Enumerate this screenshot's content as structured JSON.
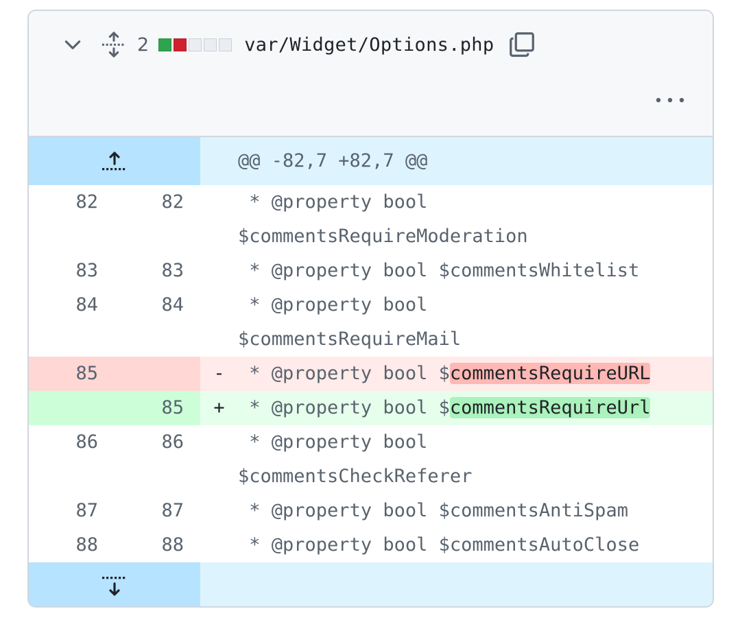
{
  "file_header": {
    "changes_count": "2",
    "diffstat": [
      "#2da44e",
      "#cf222e",
      "#eaeef2",
      "#eaeef2",
      "#eaeef2"
    ],
    "filename": "var/Widget/Options.php",
    "icons": [
      "chevron-down-icon",
      "expand-all-icon",
      "copy-icon",
      "kebab-horizontal-icon"
    ]
  },
  "hunk_header": "@@ -82,7 +82,7 @@",
  "lines": [
    {
      "type": "ctx",
      "old": "82",
      "new": "82",
      "marker": "",
      "prefix": " * @property bool\n$commentsRequireModeration",
      "hl": "",
      "suffix": ""
    },
    {
      "type": "ctx",
      "old": "83",
      "new": "83",
      "marker": "",
      "prefix": " * @property bool $commentsWhitelist",
      "hl": "",
      "suffix": ""
    },
    {
      "type": "ctx",
      "old": "84",
      "new": "84",
      "marker": "",
      "prefix": " * @property bool\n$commentsRequireMail",
      "hl": "",
      "suffix": ""
    },
    {
      "type": "del",
      "old": "85",
      "new": "",
      "marker": "-",
      "prefix": " * @property bool $",
      "hl": "commentsRequireURL",
      "suffix": ""
    },
    {
      "type": "add",
      "old": "",
      "new": "85",
      "marker": "+",
      "prefix": " * @property bool $",
      "hl": "commentsRequireUrl",
      "suffix": ""
    },
    {
      "type": "ctx",
      "old": "86",
      "new": "86",
      "marker": "",
      "prefix": " * @property bool\n$commentsCheckReferer",
      "hl": "",
      "suffix": ""
    },
    {
      "type": "ctx",
      "old": "87",
      "new": "87",
      "marker": "",
      "prefix": " * @property bool $commentsAntiSpam",
      "hl": "",
      "suffix": ""
    },
    {
      "type": "ctx",
      "old": "88",
      "new": "88",
      "marker": "",
      "prefix": " * @property bool $commentsAutoClose",
      "hl": "",
      "suffix": ""
    }
  ],
  "colors": {
    "deletion_highlight": "#ffb8b4",
    "addition_highlight": "#abf2bc",
    "hunk_gutter": "#b6e3ff",
    "hunk_bg": "#ddf4ff"
  }
}
